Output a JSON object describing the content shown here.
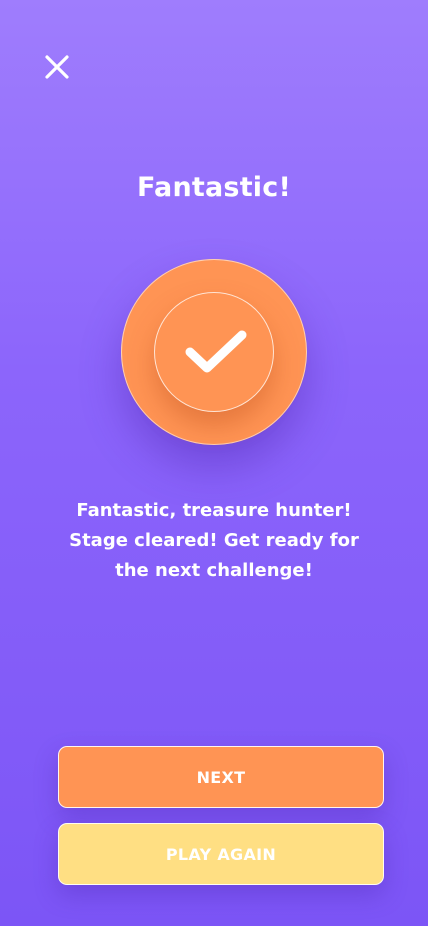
{
  "screen": {
    "title": "Fantastic!",
    "close_icon": "close-icon",
    "badge_icon": "checkmark-icon",
    "message_lines": [
      "Fantastic, treasure hunter!",
      "Stage cleared! Get ready for",
      "the next challenge!"
    ]
  },
  "buttons": {
    "next_label": "NEXT",
    "play_again_label": "PLAY AGAIN"
  },
  "colors": {
    "background_top": "#9f7dfd",
    "background_bottom": "#7c55f6",
    "accent_orange": "#ff9454",
    "accent_yellow": "#ffdf83",
    "text": "#ffffff"
  }
}
